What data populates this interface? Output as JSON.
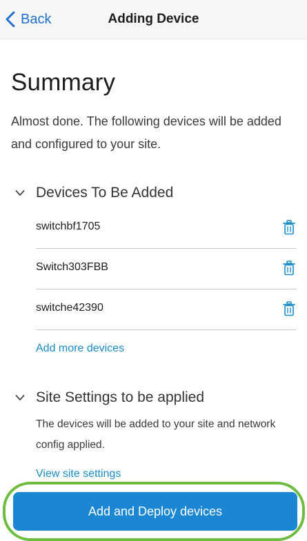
{
  "nav": {
    "back_label": "Back",
    "title": "Adding Device"
  },
  "page": {
    "title": "Summary",
    "intro": "Almost done. The following devices will be added and configured to your site."
  },
  "devices_section": {
    "label": "Devices To Be Added",
    "devices": [
      {
        "name": "switchbf1705"
      },
      {
        "name": "Switch303FBB"
      },
      {
        "name": "switche42390"
      }
    ],
    "add_more_label": "Add more devices"
  },
  "site_settings_section": {
    "label": "Site Settings to be applied",
    "description": "The devices will be added to your site and network config applied.",
    "view_link": "View site settings"
  },
  "primary_action": {
    "label": "Add and Deploy devices"
  },
  "colors": {
    "accent": "#1d6fd1",
    "link": "#1b8bc7",
    "button": "#1b87d2",
    "highlight": "#6dbb3f"
  },
  "icons": [
    "chevron-left-icon",
    "chevron-down-icon",
    "trash-icon"
  ]
}
